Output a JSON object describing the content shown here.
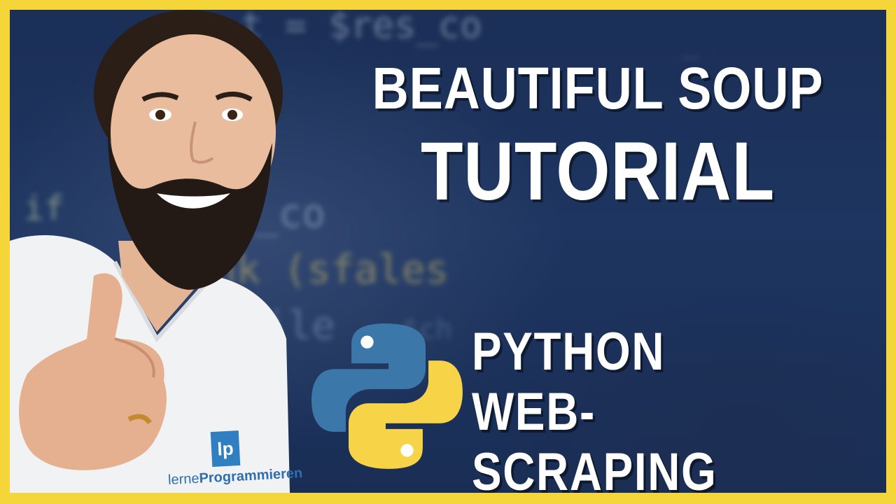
{
  "title": {
    "line1": "BEAUTIFUL SOUP",
    "line2": "TUTORIAL"
  },
  "subtitle": {
    "line1": "PYTHON",
    "line2": "WEB-SCRAPING"
  },
  "shirt_logo": {
    "badge": "lp",
    "brand_light": "lerne",
    "brand_bold": "Programmieren"
  },
  "icons": {
    "python": "python-logo-icon"
  },
  "colors": {
    "frame": "#f5d63a",
    "background": "#1d3560",
    "python_blue": "#3b77a8",
    "python_yellow": "#f7d348",
    "text": "#ffffff"
  }
}
